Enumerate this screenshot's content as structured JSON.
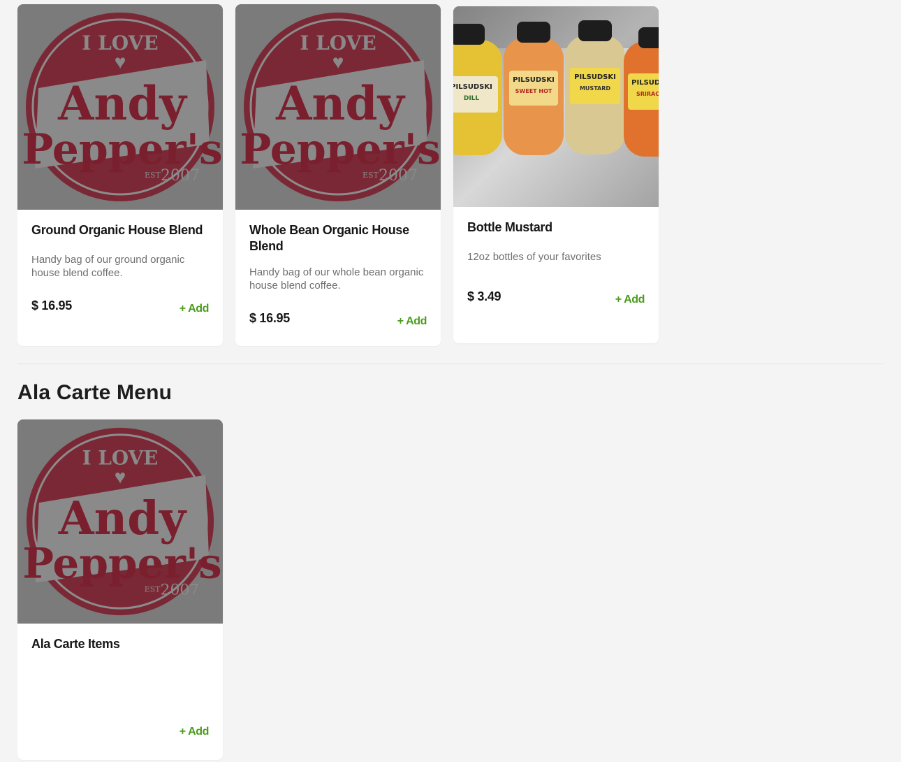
{
  "products_top": [
    {
      "title": "Ground Organic House Blend",
      "description": "Handy bag of our ground organic house blend coffee.",
      "price": "$ 16.95",
      "add_label": "+ Add",
      "image": "andy-peppers-logo"
    },
    {
      "title": "Whole Bean Organic House Blend",
      "description": "Handy bag of our whole bean organic house blend coffee.",
      "price": "$ 16.95",
      "add_label": "+ Add",
      "image": "andy-peppers-logo"
    },
    {
      "title": "Bottle Mustard",
      "description": "12oz bottles of your favorites",
      "price": "$ 3.49",
      "add_label": "+ Add",
      "image": "mustard-bottles-photo"
    }
  ],
  "section": {
    "title": "Ala Carte Menu"
  },
  "products_bottom": [
    {
      "title": "Ala Carte Items",
      "description": "",
      "price": "",
      "add_label": "+ Add",
      "image": "andy-peppers-logo"
    }
  ],
  "logo": {
    "line1": "I LOVE",
    "line2": "Andy",
    "line3": "Pepper's",
    "est": "EST",
    "year": "2007"
  },
  "bottles": [
    {
      "brand": "PILSUDSKI",
      "flavor": "DILL",
      "color": "#e4c234"
    },
    {
      "brand": "PILSUDSKI",
      "flavor": "SWEET HOT",
      "color": "#e8944a"
    },
    {
      "brand": "PILSUDSKI",
      "flavor": "MUSTARD",
      "color": "#d9c892"
    },
    {
      "brand": "PILSUDSKI",
      "flavor": "SRIRACHA",
      "color": "#e0722e"
    }
  ],
  "colors": {
    "accent_add": "#4b9b1c",
    "logo_red": "#7a1f2e",
    "page_bg": "#f4f4f4"
  }
}
